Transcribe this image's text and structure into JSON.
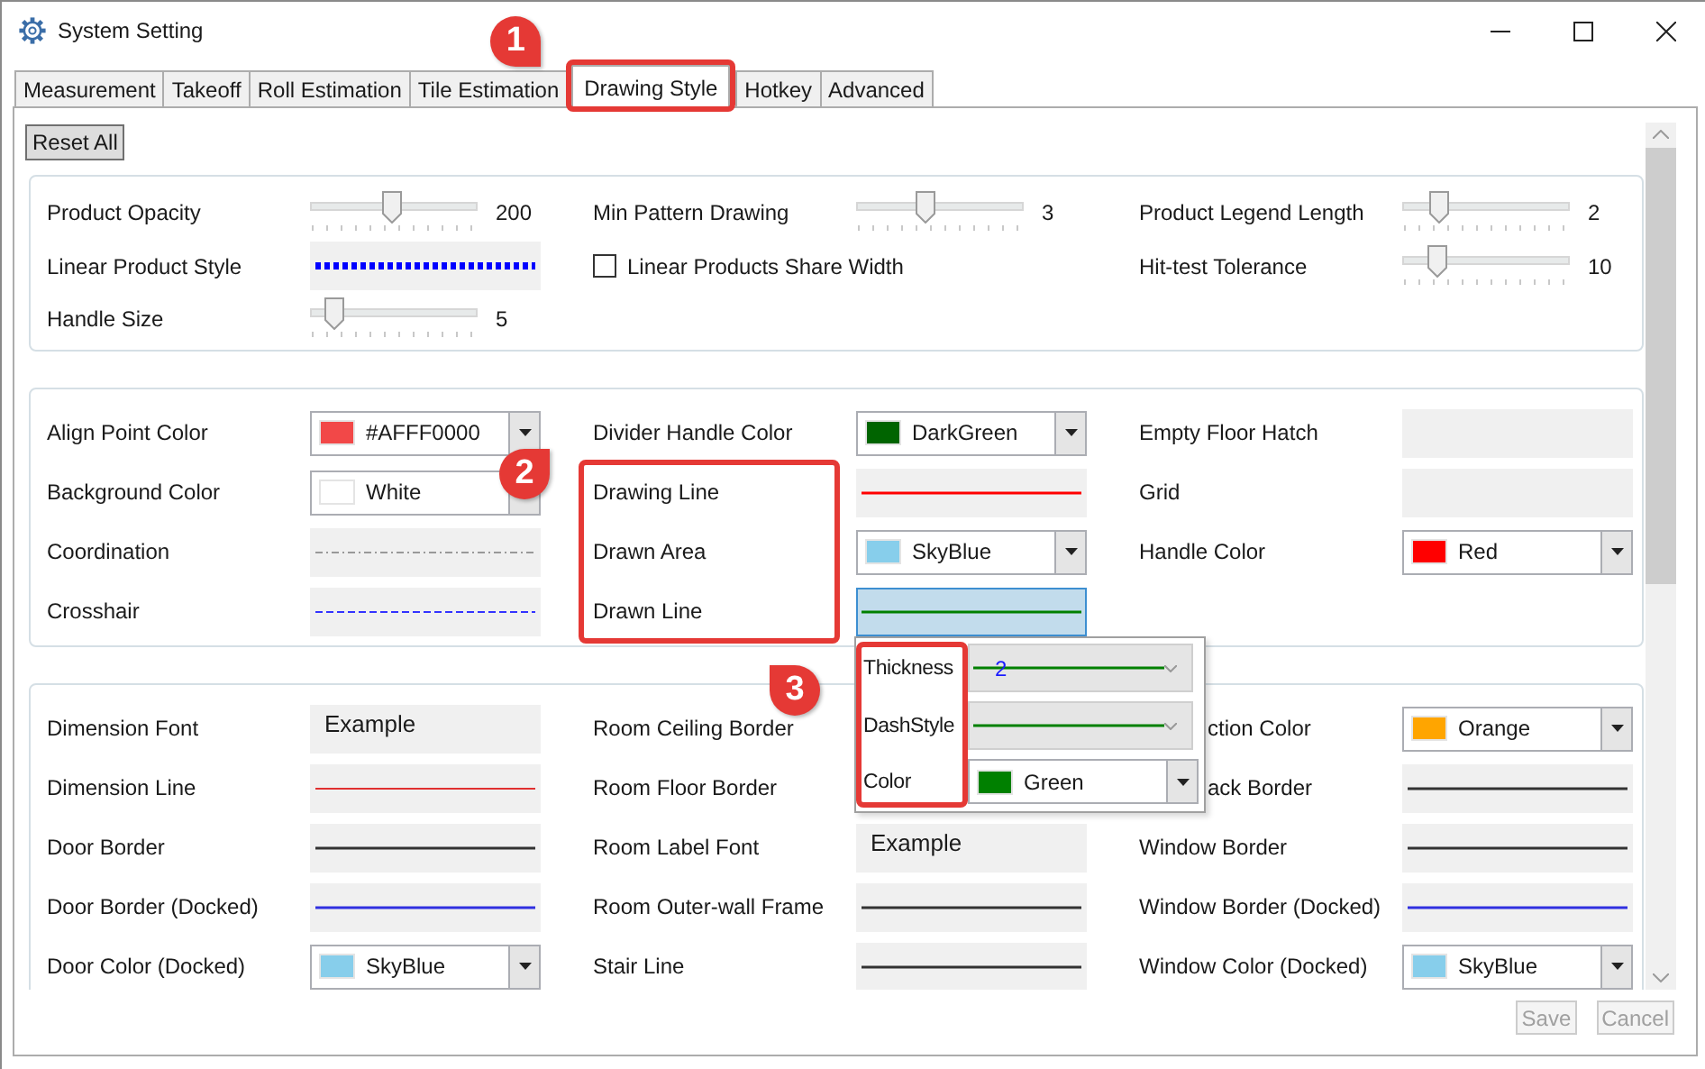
{
  "window": {
    "title": "System Setting"
  },
  "tabs": [
    {
      "label": "Measurement",
      "selected": false
    },
    {
      "label": "Takeoff",
      "selected": false
    },
    {
      "label": "Roll Estimation",
      "selected": false
    },
    {
      "label": "Tile Estimation",
      "selected": false
    },
    {
      "label": "Drawing Style",
      "selected": true
    },
    {
      "label": "Hotkey",
      "selected": false
    },
    {
      "label": "Advanced",
      "selected": false
    }
  ],
  "reset_button": "Reset All",
  "groups": [
    {
      "cells": [
        {
          "label": "Product Opacity",
          "control": {
            "kind": "slider",
            "level": 0.49,
            "reading": "200"
          }
        },
        {
          "label": "Min Pattern Drawing",
          "control": {
            "kind": "slider",
            "level": 0.4,
            "reading": "3"
          }
        },
        {
          "label": "Product Legend Length",
          "control": {
            "kind": "slider",
            "level": 0.18,
            "reading": "2"
          }
        },
        {
          "label": "Linear Product Style",
          "control": {
            "kind": "dotted-line",
            "color": "#0000ff"
          }
        },
        {
          "label": "Linear Products Share Width",
          "control": {
            "kind": "checkbox",
            "checked": false
          }
        },
        {
          "label": "Hit-test Tolerance",
          "control": {
            "kind": "slider",
            "level": 0.17,
            "reading": "10"
          }
        },
        {
          "label": "Handle Size",
          "control": {
            "kind": "slider",
            "level": 0.1,
            "reading": "5"
          }
        }
      ]
    },
    {
      "cells": [
        {
          "label": "Align Point Color",
          "control": {
            "kind": "color",
            "color": "#f24848",
            "text": "#AFFF0000"
          }
        },
        {
          "label": "Divider Handle Color",
          "control": {
            "kind": "color",
            "color": "#006400",
            "text": "DarkGreen"
          }
        },
        {
          "label": "Empty Floor Hatch",
          "control": {
            "kind": "pattern"
          }
        },
        {
          "label": "Background Color",
          "control": {
            "kind": "color",
            "color": "#ffffff",
            "text": "White"
          }
        },
        {
          "label": "Drawing Line",
          "control": {
            "kind": "solid-line",
            "color": "#ff0000"
          }
        },
        {
          "label": "Grid",
          "control": {
            "kind": "pattern"
          }
        },
        {
          "label": "Coordination",
          "control": {
            "kind": "dashdot-line",
            "color": "#999999"
          }
        },
        {
          "label": "Drawn Area",
          "control": {
            "kind": "color",
            "color": "#87ceeb",
            "text": "SkyBlue"
          }
        },
        {
          "label": "Handle Color",
          "control": {
            "kind": "color",
            "color": "#ff0000",
            "text": "Red"
          }
        },
        {
          "label": "Crosshair",
          "control": {
            "kind": "dashed-line",
            "color": "#3333ff"
          }
        },
        {
          "label": "Drawn Line",
          "control": {
            "kind": "solid-line",
            "color": "#008000",
            "selected": true
          }
        }
      ]
    },
    {
      "cells": [
        {
          "label": "Dimension Font",
          "control": {
            "kind": "font",
            "text": "Example"
          }
        },
        {
          "label": "Room Ceiling Border"
        },
        {
          "label": "ction Color",
          "cut": true,
          "control": {
            "kind": "color",
            "color": "#ffa500",
            "text": "Orange"
          }
        },
        {
          "label": "Dimension Line",
          "control": {
            "kind": "thin-line",
            "color": "#e03030"
          }
        },
        {
          "label": "Room Floor Border"
        },
        {
          "label": "ack Border",
          "cut": true,
          "control": {
            "kind": "solid-line",
            "color": "#333333"
          }
        },
        {
          "label": "Door Border",
          "control": {
            "kind": "solid-line",
            "color": "#333333"
          }
        },
        {
          "label": "Room Label Font",
          "control": {
            "kind": "font",
            "text": "Example"
          }
        },
        {
          "label": "Window Border",
          "control": {
            "kind": "solid-line",
            "color": "#333333"
          }
        },
        {
          "label": "Door Border (Docked)",
          "control": {
            "kind": "solid-line",
            "color": "#3030e0"
          }
        },
        {
          "label": "Room Outer-wall Frame",
          "control": {
            "kind": "solid-line",
            "color": "#333333"
          }
        },
        {
          "label": "Window Border (Docked)",
          "control": {
            "kind": "solid-line",
            "color": "#3030e0"
          }
        },
        {
          "label": "Door Color (Docked)",
          "control": {
            "kind": "color",
            "color": "#87ceeb",
            "text": "SkyBlue"
          }
        },
        {
          "label": "Stair Line",
          "control": {
            "kind": "solid-line",
            "color": "#333333"
          }
        },
        {
          "label": "Window Color (Docked)",
          "control": {
            "kind": "color",
            "color": "#87ceeb",
            "text": "SkyBlue"
          }
        }
      ]
    }
  ],
  "popup": {
    "rows": [
      {
        "label": "Thickness",
        "control": {
          "kind": "line-combo",
          "color": "#008000",
          "value": "2"
        }
      },
      {
        "label": "DashStyle",
        "control": {
          "kind": "line-combo",
          "color": "#008000"
        }
      },
      {
        "label": "Color",
        "control": {
          "kind": "color",
          "color": "#008000",
          "text": "Green"
        }
      }
    ]
  },
  "buttons": [
    {
      "label": "Save",
      "disabled": true
    },
    {
      "label": "Cancel",
      "disabled": true
    }
  ],
  "annotations": [
    {
      "label": "1"
    },
    {
      "label": "2"
    },
    {
      "label": "3"
    }
  ]
}
